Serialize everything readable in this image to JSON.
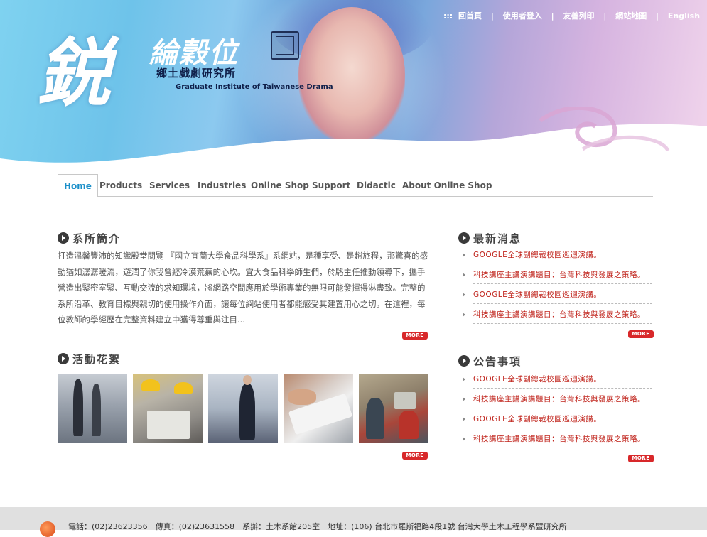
{
  "banner": {
    "logo_big": "鋭",
    "logo_small": "綸穀位",
    "institute_cn": "鄉土戲劇研究所",
    "institute_en": "Graduate Institute of Taiwanese Drama"
  },
  "toplinks": {
    "prefix": ":::",
    "items": [
      "回首頁",
      "使用者登入",
      "友善列印",
      "網站地圖",
      "English"
    ],
    "separator": "|"
  },
  "nav": {
    "items": [
      "Home",
      "Products",
      "Services",
      "Industries",
      "Online Shop",
      "Support",
      "Didactic",
      "About Online Shop"
    ],
    "active": "Home",
    "active_color": "#1a8fc9"
  },
  "intro": {
    "title": "系所簡介",
    "body": "打造溫馨豐沛的知識殿堂閱覽 『國立宜蘭大學食品科學系』系網站，是種享受、是趟旅程，那驚喜的感動猶如潺潺暖流，遊潤了你我曾經冷漠荒蕪的心坎。宜大食品科學師生們，於駱主任推動領導下，攜手營造出緊密室緊、互動交流的求知環境，將網路空間應用於學術專業的無限可能發揮得淋盡致。完整的系所沿革、教育目標與親切的使用操作介面，讓每位網站使用者都能感受其建置用心之切。在這裡，每位教師的學經歷在完整資料建立中獲得尊重與注目...",
    "more": "MORE"
  },
  "activities": {
    "title": "活動花絮",
    "photos": [
      "business-people-walking",
      "engineers-with-blueprint",
      "presenter-at-board",
      "hands-typing-keyboard",
      "office-team-at-computer"
    ],
    "more": "MORE"
  },
  "news": {
    "title": "最新消息",
    "items": [
      "GOOGLE全球副總裁校園巡迴演講。",
      "科技講座主講演講題目：台灣科技與發展之策略。",
      "GOOGLE全球副總裁校園巡迴演講。",
      "科技講座主講演講題目：台灣科技與發展之策略。"
    ],
    "more": "MORE"
  },
  "announcements": {
    "title": "公告事項",
    "items": [
      "GOOGLE全球副總裁校園巡迴演講。",
      "科技講座主講演講題目：台灣科技與發展之策略。",
      "GOOGLE全球副總裁校園巡迴演講。",
      "科技講座主講演講題目：台灣科技與發展之策略。"
    ],
    "more": "MORE"
  },
  "footer": {
    "text": "電話：(02)23623356　傳真：(02)23631558　系辦：土木系館205室　地址：(106) 台北市羅斯福路4段1號 台灣大學土木工程學系暨研究所"
  },
  "colors": {
    "link_red": "#c0241c",
    "more_button": "#d8282a",
    "footer_bg": "#e0e0e0"
  }
}
